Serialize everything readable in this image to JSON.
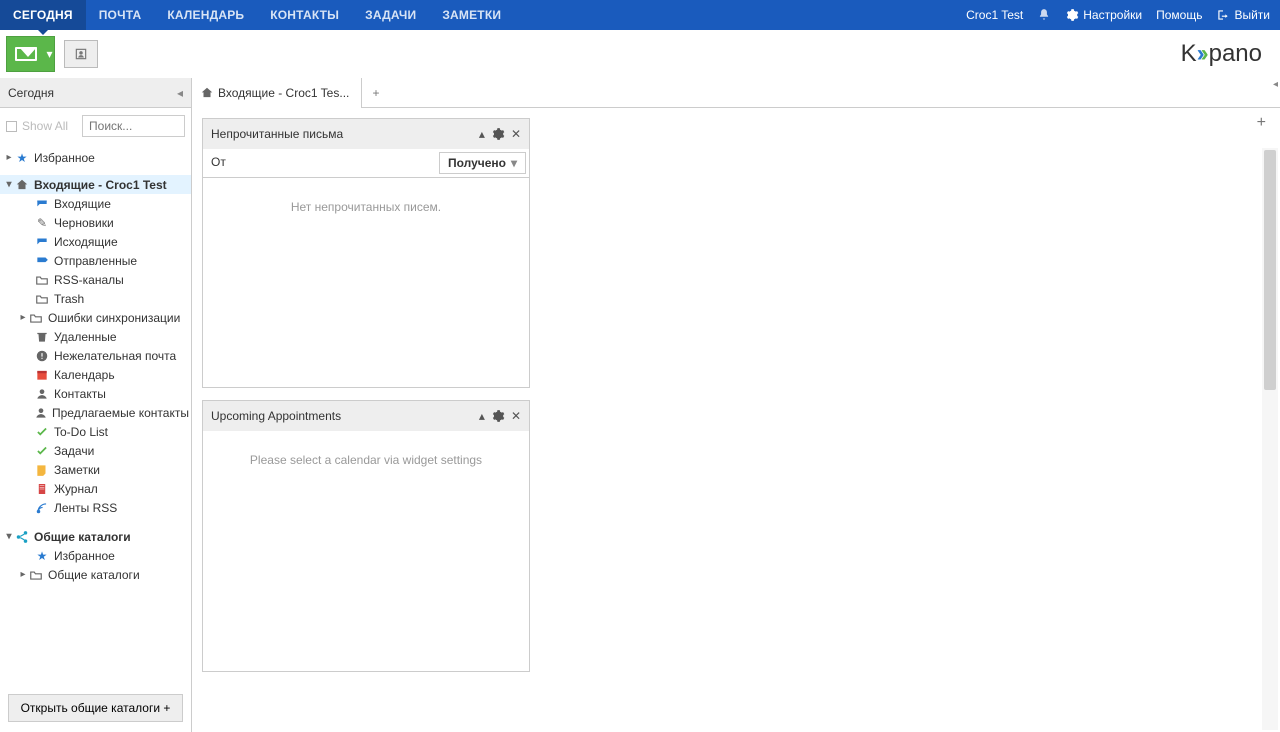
{
  "topbar": {
    "tabs": [
      "СЕГОДНЯ",
      "ПОЧТА",
      "КАЛЕНДАРЬ",
      "КОНТАКТЫ",
      "ЗАДАЧИ",
      "ЗАМЕТКИ"
    ],
    "user": "Croc1 Test",
    "settings": "Настройки",
    "help": "Помощь",
    "logout": "Выйти"
  },
  "brand": {
    "text_a": "K",
    "text_b": "pano"
  },
  "sidebar": {
    "header": "Сегодня",
    "showall": "Show All",
    "search_placeholder": "Поиск...",
    "favorites_root": "Избранное",
    "inbox_root": "Входящие - Croc1 Test",
    "nodes": [
      {
        "label": "Входящие",
        "icon": "inbox",
        "clr": "blue"
      },
      {
        "label": "Черновики",
        "icon": "pencil",
        "clr": "grey"
      },
      {
        "label": "Исходящие",
        "icon": "outbox",
        "clr": "blue"
      },
      {
        "label": "Отправленные",
        "icon": "sent",
        "clr": "blue"
      },
      {
        "label": "RSS-каналы",
        "icon": "folder",
        "clr": "grey"
      },
      {
        "label": "Trash",
        "icon": "folder",
        "clr": "grey"
      },
      {
        "label": "Ошибки синхронизации",
        "icon": "folder",
        "clr": "grey",
        "has_children": true
      },
      {
        "label": "Удаленные",
        "icon": "trash",
        "clr": "grey"
      },
      {
        "label": "Нежелательная почта",
        "icon": "warn",
        "clr": "grey"
      },
      {
        "label": "Календарь",
        "icon": "cal",
        "clr": "cal-red"
      },
      {
        "label": "Контакты",
        "icon": "person",
        "clr": "grey"
      },
      {
        "label": "Предлагаемые контакты",
        "icon": "person",
        "clr": "grey"
      },
      {
        "label": "To-Do List",
        "icon": "task",
        "clr": "green"
      },
      {
        "label": "Задачи",
        "icon": "task",
        "clr": "green"
      },
      {
        "label": "Заметки",
        "icon": "note",
        "clr": "orange"
      },
      {
        "label": "Журнал",
        "icon": "journal",
        "clr": "red"
      },
      {
        "label": "Ленты RSS",
        "icon": "rss",
        "clr": "blue"
      }
    ],
    "shared_root": "Общие каталоги",
    "shared_fav": "Избранное",
    "shared_cat": "Общие каталоги",
    "open_catalogs": "Открыть общие каталоги +"
  },
  "main": {
    "tab_label": "Входящие - Croc1 Tes...",
    "unread": {
      "title": "Непрочитанные письма",
      "col_from": "От",
      "col_recv": "Получено",
      "empty": "Нет непрочитанных писем."
    },
    "appts": {
      "title": "Upcoming Appointments",
      "empty": "Please select a calendar via widget settings"
    }
  }
}
